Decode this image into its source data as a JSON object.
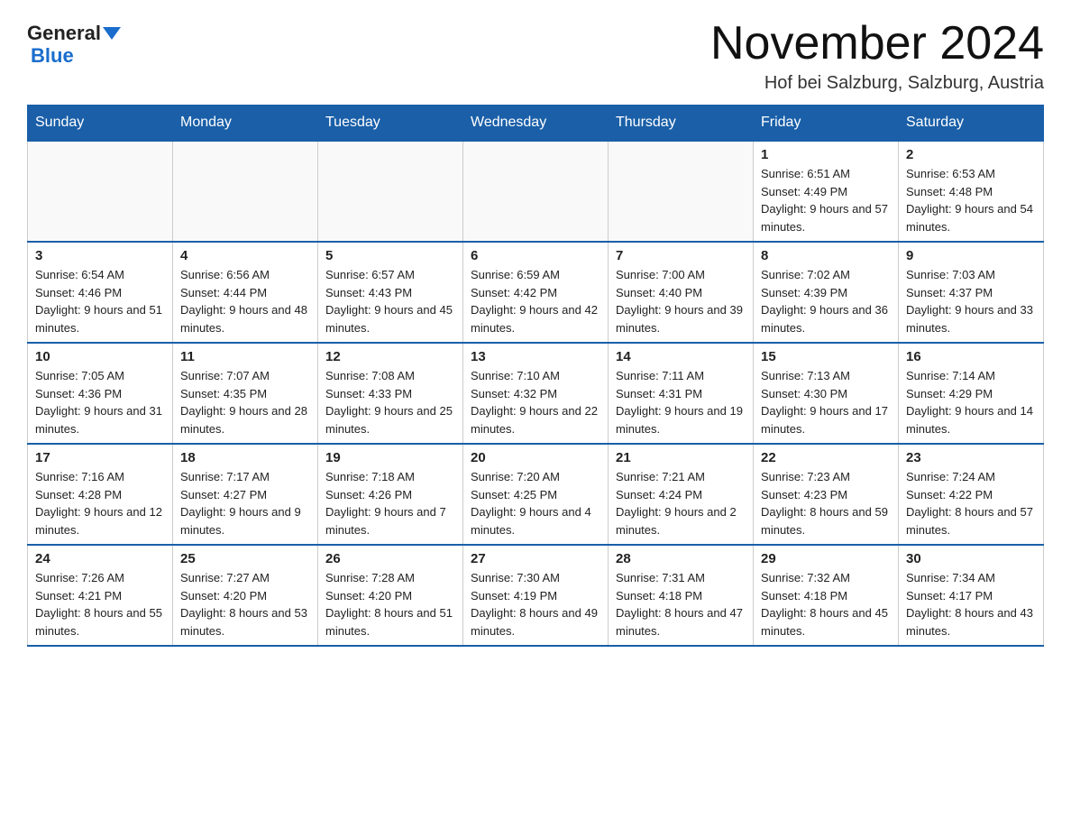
{
  "header": {
    "logo_line1": "General",
    "logo_line2": "Blue",
    "month_title": "November 2024",
    "location": "Hof bei Salzburg, Salzburg, Austria"
  },
  "weekdays": [
    "Sunday",
    "Monday",
    "Tuesday",
    "Wednesday",
    "Thursday",
    "Friday",
    "Saturday"
  ],
  "weeks": [
    [
      {
        "day": "",
        "info": ""
      },
      {
        "day": "",
        "info": ""
      },
      {
        "day": "",
        "info": ""
      },
      {
        "day": "",
        "info": ""
      },
      {
        "day": "",
        "info": ""
      },
      {
        "day": "1",
        "info": "Sunrise: 6:51 AM\nSunset: 4:49 PM\nDaylight: 9 hours and 57 minutes."
      },
      {
        "day": "2",
        "info": "Sunrise: 6:53 AM\nSunset: 4:48 PM\nDaylight: 9 hours and 54 minutes."
      }
    ],
    [
      {
        "day": "3",
        "info": "Sunrise: 6:54 AM\nSunset: 4:46 PM\nDaylight: 9 hours and 51 minutes."
      },
      {
        "day": "4",
        "info": "Sunrise: 6:56 AM\nSunset: 4:44 PM\nDaylight: 9 hours and 48 minutes."
      },
      {
        "day": "5",
        "info": "Sunrise: 6:57 AM\nSunset: 4:43 PM\nDaylight: 9 hours and 45 minutes."
      },
      {
        "day": "6",
        "info": "Sunrise: 6:59 AM\nSunset: 4:42 PM\nDaylight: 9 hours and 42 minutes."
      },
      {
        "day": "7",
        "info": "Sunrise: 7:00 AM\nSunset: 4:40 PM\nDaylight: 9 hours and 39 minutes."
      },
      {
        "day": "8",
        "info": "Sunrise: 7:02 AM\nSunset: 4:39 PM\nDaylight: 9 hours and 36 minutes."
      },
      {
        "day": "9",
        "info": "Sunrise: 7:03 AM\nSunset: 4:37 PM\nDaylight: 9 hours and 33 minutes."
      }
    ],
    [
      {
        "day": "10",
        "info": "Sunrise: 7:05 AM\nSunset: 4:36 PM\nDaylight: 9 hours and 31 minutes."
      },
      {
        "day": "11",
        "info": "Sunrise: 7:07 AM\nSunset: 4:35 PM\nDaylight: 9 hours and 28 minutes."
      },
      {
        "day": "12",
        "info": "Sunrise: 7:08 AM\nSunset: 4:33 PM\nDaylight: 9 hours and 25 minutes."
      },
      {
        "day": "13",
        "info": "Sunrise: 7:10 AM\nSunset: 4:32 PM\nDaylight: 9 hours and 22 minutes."
      },
      {
        "day": "14",
        "info": "Sunrise: 7:11 AM\nSunset: 4:31 PM\nDaylight: 9 hours and 19 minutes."
      },
      {
        "day": "15",
        "info": "Sunrise: 7:13 AM\nSunset: 4:30 PM\nDaylight: 9 hours and 17 minutes."
      },
      {
        "day": "16",
        "info": "Sunrise: 7:14 AM\nSunset: 4:29 PM\nDaylight: 9 hours and 14 minutes."
      }
    ],
    [
      {
        "day": "17",
        "info": "Sunrise: 7:16 AM\nSunset: 4:28 PM\nDaylight: 9 hours and 12 minutes."
      },
      {
        "day": "18",
        "info": "Sunrise: 7:17 AM\nSunset: 4:27 PM\nDaylight: 9 hours and 9 minutes."
      },
      {
        "day": "19",
        "info": "Sunrise: 7:18 AM\nSunset: 4:26 PM\nDaylight: 9 hours and 7 minutes."
      },
      {
        "day": "20",
        "info": "Sunrise: 7:20 AM\nSunset: 4:25 PM\nDaylight: 9 hours and 4 minutes."
      },
      {
        "day": "21",
        "info": "Sunrise: 7:21 AM\nSunset: 4:24 PM\nDaylight: 9 hours and 2 minutes."
      },
      {
        "day": "22",
        "info": "Sunrise: 7:23 AM\nSunset: 4:23 PM\nDaylight: 8 hours and 59 minutes."
      },
      {
        "day": "23",
        "info": "Sunrise: 7:24 AM\nSunset: 4:22 PM\nDaylight: 8 hours and 57 minutes."
      }
    ],
    [
      {
        "day": "24",
        "info": "Sunrise: 7:26 AM\nSunset: 4:21 PM\nDaylight: 8 hours and 55 minutes."
      },
      {
        "day": "25",
        "info": "Sunrise: 7:27 AM\nSunset: 4:20 PM\nDaylight: 8 hours and 53 minutes."
      },
      {
        "day": "26",
        "info": "Sunrise: 7:28 AM\nSunset: 4:20 PM\nDaylight: 8 hours and 51 minutes."
      },
      {
        "day": "27",
        "info": "Sunrise: 7:30 AM\nSunset: 4:19 PM\nDaylight: 8 hours and 49 minutes."
      },
      {
        "day": "28",
        "info": "Sunrise: 7:31 AM\nSunset: 4:18 PM\nDaylight: 8 hours and 47 minutes."
      },
      {
        "day": "29",
        "info": "Sunrise: 7:32 AM\nSunset: 4:18 PM\nDaylight: 8 hours and 45 minutes."
      },
      {
        "day": "30",
        "info": "Sunrise: 7:34 AM\nSunset: 4:17 PM\nDaylight: 8 hours and 43 minutes."
      }
    ]
  ]
}
